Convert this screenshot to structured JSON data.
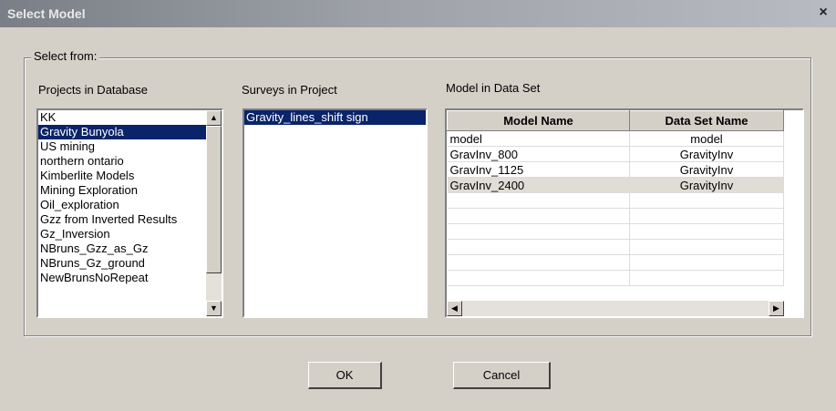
{
  "window": {
    "title": "Select Model",
    "close_glyph": "×"
  },
  "group": {
    "label": "Select from:"
  },
  "projects": {
    "label": "Projects in Database",
    "items": [
      "KK",
      "Gravity Bunyola",
      "US mining",
      "northern ontario",
      "Kimberlite Models",
      "Mining Exploration",
      "Oil_exploration",
      "Gzz from Inverted Results",
      "Gz_Inversion",
      "NBruns_Gzz_as_Gz",
      "NBruns_Gz_ground",
      "NewBrunsNoRepeat"
    ],
    "selected_index": 1
  },
  "surveys": {
    "label": "Surveys in Project",
    "items": [
      "Gravity_lines_shift sign"
    ],
    "selected_index": 0
  },
  "models": {
    "label": "Model in Data Set",
    "columns": [
      "Model Name",
      "Data Set Name"
    ],
    "rows": [
      [
        "model",
        "model"
      ],
      [
        "GravInv_800",
        "GravityInv"
      ],
      [
        "GravInv_1125",
        "GravityInv"
      ],
      [
        "GravInv_2400",
        "GravityInv"
      ]
    ],
    "highlighted_row": 3
  },
  "buttons": {
    "ok": "OK",
    "cancel": "Cancel"
  },
  "icons": {
    "scroll_up": "▲",
    "scroll_down": "▼",
    "scroll_left": "◀",
    "scroll_right": "▶"
  }
}
